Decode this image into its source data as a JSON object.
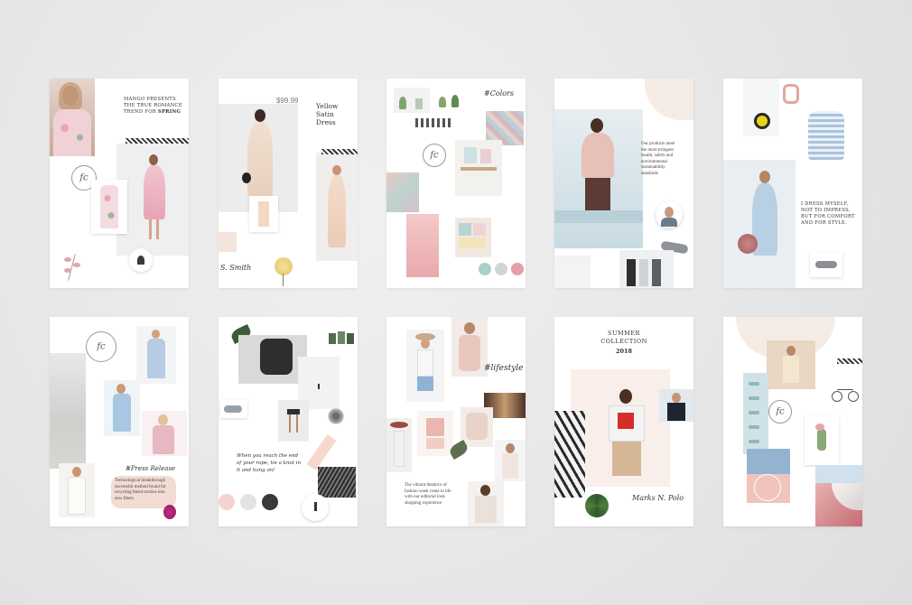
{
  "cards": {
    "c1": {
      "lines": [
        "MANGO PRESENTS",
        "THE TRUE ROMANCE",
        "TREND FOR "
      ],
      "bold": "SPRING",
      "logo": "fc"
    },
    "c2": {
      "price": "$99.99",
      "title": [
        "Yellow",
        "Satin",
        "Dress"
      ],
      "signature": "S. Smith"
    },
    "c3": {
      "heading": "#Colors",
      "logo": "fc",
      "dots": [
        "#a9cfc9",
        "#cfd6d9",
        "#e2a1a6"
      ]
    },
    "c4": {
      "text": [
        "Our products meet",
        "the most stringent",
        "health, safety and",
        "environmental",
        "sustainability",
        "standards"
      ]
    },
    "c5": {
      "text": [
        "I DRESS MYSELF,",
        "NOT TO IMPRESS,",
        "BUT FOR COMFORT",
        "AND FOR STYLE."
      ]
    },
    "c6": {
      "logo": "fc",
      "heading": "#Press Release",
      "text": [
        "Technological breakthrough",
        "successful method found for",
        "recycling blend textiles into",
        "new fibers"
      ]
    },
    "c7": {
      "quote": [
        "When you reach the end",
        "of your rope, tie a knot in",
        "it and hang on!"
      ],
      "dots": [
        "#f4d4cf",
        "#e3e3e6",
        "#3a3a3a"
      ]
    },
    "c8": {
      "heading": "#lifestyle",
      "text": [
        "The vibrant theatrics of",
        "fashion week come to life",
        "with our editorial look",
        "shopping experience"
      ]
    },
    "c9": {
      "title": [
        "SUMMER",
        "COLLECTION"
      ],
      "year": "2018",
      "signature": "Marks N. Polo"
    },
    "c10": {
      "logo": "fc"
    }
  },
  "colors": {
    "background": "#e9e9e9",
    "card": "#ffffff",
    "blush": "#f3d5cf",
    "powder": "#c8dbe8",
    "charcoal": "#333333"
  }
}
